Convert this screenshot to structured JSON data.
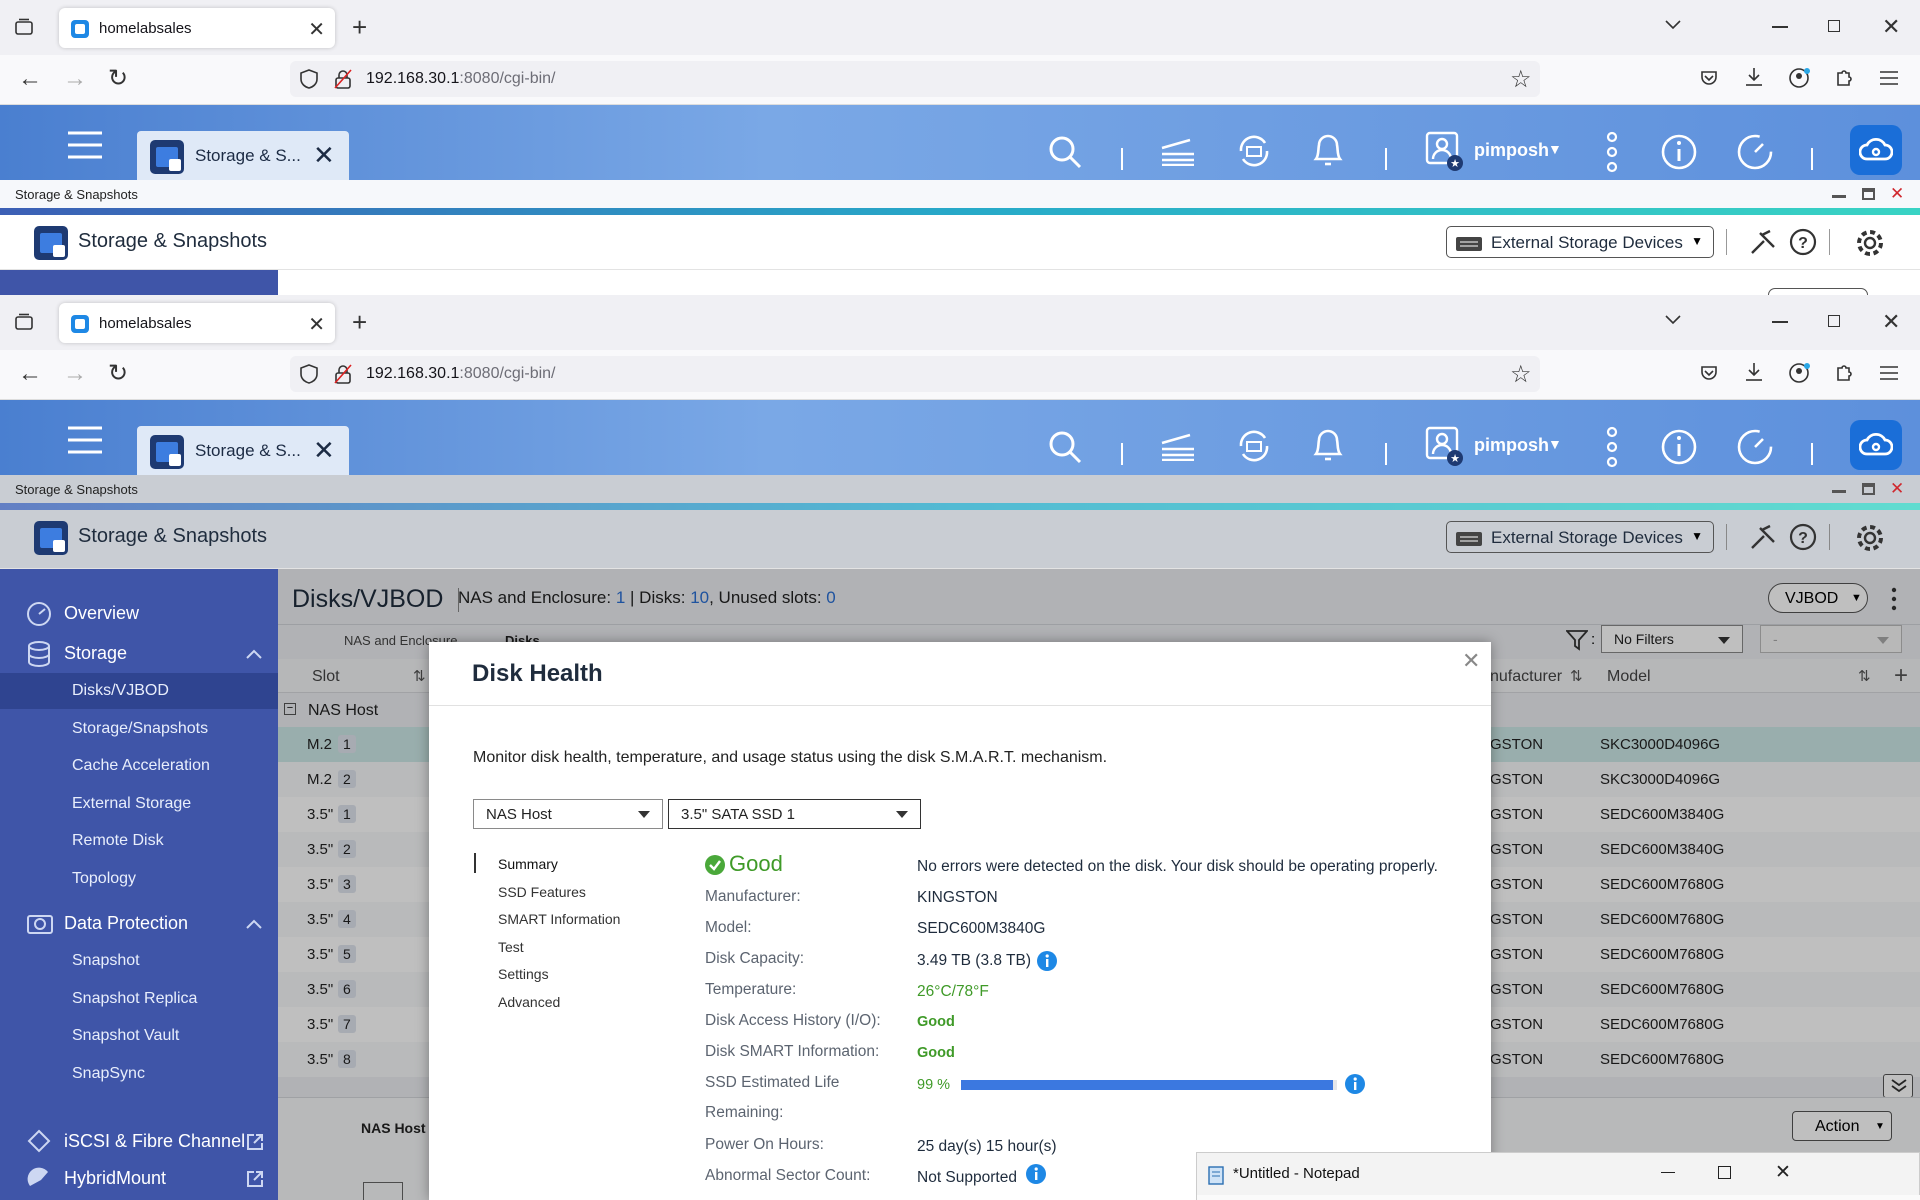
{
  "browser": {
    "tab_title": "homelabsales",
    "url_host": "192.168.30.1",
    "url_path": ":8080/cgi-bin/"
  },
  "qts": {
    "app_tab": "Storage & S...",
    "username": "pimposh",
    "window_title": "Storage & Snapshots",
    "app_title": "Storage & Snapshots",
    "external_btn": "External Storage Devices"
  },
  "page": {
    "title": "Disks/VJBOD",
    "summary_l1": "NAS and Enclosure:",
    "summary_v1": "1",
    "summary_l2": "Disks:",
    "summary_v2": "10",
    "summary_l3": ", Unused slots:",
    "summary_v3": "0",
    "vjbod": "VJBOD",
    "subtab1": "NAS and Enclosure",
    "subtab2": "Disks",
    "filter": "No Filters",
    "filter2": "-",
    "col_slot": "Slot",
    "col_manufacturer": "nufacturer",
    "col_model": "Model",
    "group": "NAS Host",
    "action": "Action",
    "bottom_label": "NAS Host"
  },
  "rows": [
    {
      "slot": "M.2",
      "num": "1",
      "mfr": "GSTON",
      "model": "SKC3000D4096G"
    },
    {
      "slot": "M.2",
      "num": "2",
      "mfr": "GSTON",
      "model": "SKC3000D4096G"
    },
    {
      "slot": "3.5\"",
      "num": "1",
      "mfr": "GSTON",
      "model": "SEDC600M3840G"
    },
    {
      "slot": "3.5\"",
      "num": "2",
      "mfr": "GSTON",
      "model": "SEDC600M3840G"
    },
    {
      "slot": "3.5\"",
      "num": "3",
      "mfr": "GSTON",
      "model": "SEDC600M7680G"
    },
    {
      "slot": "3.5\"",
      "num": "4",
      "mfr": "GSTON",
      "model": "SEDC600M7680G"
    },
    {
      "slot": "3.5\"",
      "num": "5",
      "mfr": "GSTON",
      "model": "SEDC600M7680G"
    },
    {
      "slot": "3.5\"",
      "num": "6",
      "mfr": "GSTON",
      "model": "SEDC600M7680G"
    },
    {
      "slot": "3.5\"",
      "num": "7",
      "mfr": "GSTON",
      "model": "SEDC600M7680G"
    },
    {
      "slot": "3.5\"",
      "num": "8",
      "mfr": "GSTON",
      "model": "SEDC600M7680G"
    }
  ],
  "sidebar": {
    "overview": "Overview",
    "storage": "Storage",
    "storage_items": [
      "Disks/VJBOD",
      "Storage/Snapshots",
      "Cache Acceleration",
      "External Storage",
      "Remote Disk",
      "Topology"
    ],
    "data_protection": "Data Protection",
    "dp_items": [
      "Snapshot",
      "Snapshot Replica",
      "Snapshot Vault",
      "SnapSync"
    ],
    "iscsi": "iSCSI & Fibre Channel",
    "hybridmount": "HybridMount"
  },
  "dialog": {
    "title": "Disk Health",
    "description": "Monitor disk health, temperature, and usage status using the disk S.M.A.R.T. mechanism.",
    "select_host": "NAS Host",
    "select_disk": "3.5\" SATA SSD 1",
    "nav": [
      "Summary",
      "SSD Features",
      "SMART Information",
      "Test",
      "Settings",
      "Advanced"
    ],
    "status": "Good",
    "status_msg": "No errors were detected on the disk. Your disk should be operating properly.",
    "labels": {
      "manufacturer": "Manufacturer:",
      "model": "Model:",
      "capacity": "Disk Capacity:",
      "temperature": "Temperature:",
      "access": "Disk Access History (I/O):",
      "smart": "Disk SMART Information:",
      "life1": "SSD Estimated Life",
      "life2": "Remaining:",
      "hours": "Power On Hours:",
      "sector": "Abnormal Sector Count:"
    },
    "values": {
      "manufacturer": "KINGSTON",
      "model": "SEDC600M3840G",
      "capacity": "3.49 TB (3.8 TB)",
      "temperature": "26°C/78°F",
      "access": "Good",
      "smart": "Good",
      "life": "99 %",
      "hours": "25 day(s) 15 hour(s)",
      "sector": "Not Supported"
    },
    "life_fraction": 0.99
  },
  "notepad": {
    "title": "*Untitled - Notepad"
  }
}
